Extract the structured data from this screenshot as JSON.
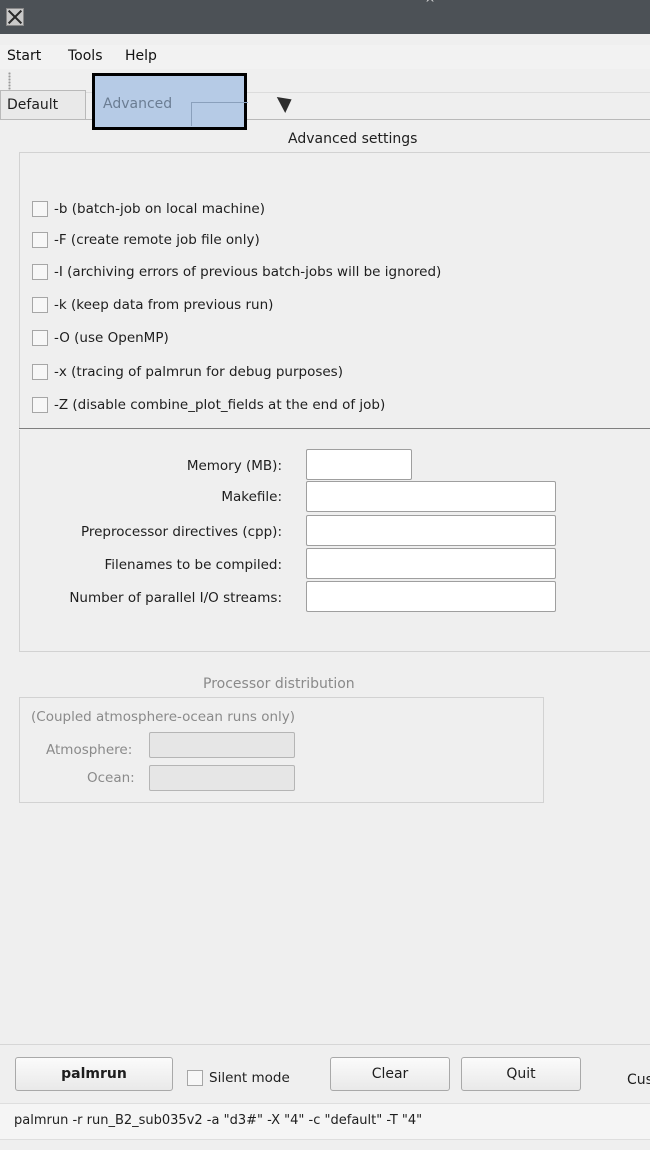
{
  "title_mark": "^",
  "menu": {
    "start": "Start",
    "tools": "Tools",
    "help": "Help"
  },
  "tabs": [
    {
      "label": "Default",
      "active": false
    },
    {
      "label": "Advanced",
      "active": true
    }
  ],
  "advanced": {
    "heading": "Advanced settings",
    "options": [
      {
        "label": "-b  (batch-job on local machine)",
        "checked": false
      },
      {
        "label": "-F (create remote job file only)",
        "checked": false
      },
      {
        "label": "-I  (archiving errors of previous batch-jobs will be ignored)",
        "checked": false
      },
      {
        "label": "-k  (keep data from previous run)",
        "checked": false
      },
      {
        "label": "-O  (use OpenMP)",
        "checked": false
      },
      {
        "label": "-x  (tracing of palmrun for debug purposes)",
        "checked": false
      },
      {
        "label": "-Z  (disable combine_plot_fields at the end of job)",
        "checked": false
      }
    ],
    "fields": [
      {
        "label": "Memory (MB):",
        "value": ""
      },
      {
        "label": "Makefile:",
        "value": ""
      },
      {
        "label": "Preprocessor directives (cpp):",
        "value": ""
      },
      {
        "label": "Filenames to be compiled:",
        "value": ""
      },
      {
        "label": "Number of parallel I/O streams:",
        "value": ""
      }
    ]
  },
  "processor": {
    "heading": "Processor distribution",
    "note": "(Coupled atmosphere-ocean runs only)",
    "atmosphere_label": "Atmosphere:",
    "atmosphere_value": "",
    "ocean_label": "Ocean:",
    "ocean_value": ""
  },
  "bottom": {
    "palmrun_button": "palmrun",
    "silent_label": "Silent mode",
    "silent_checked": false,
    "clear_button": "Clear",
    "quit_button": "Quit",
    "cus_label": "Cus",
    "command": "palmrun -r run_B2_sub035v2 -a \"d3#\" -X \"4\" -c \"default\" -T \"4\""
  }
}
